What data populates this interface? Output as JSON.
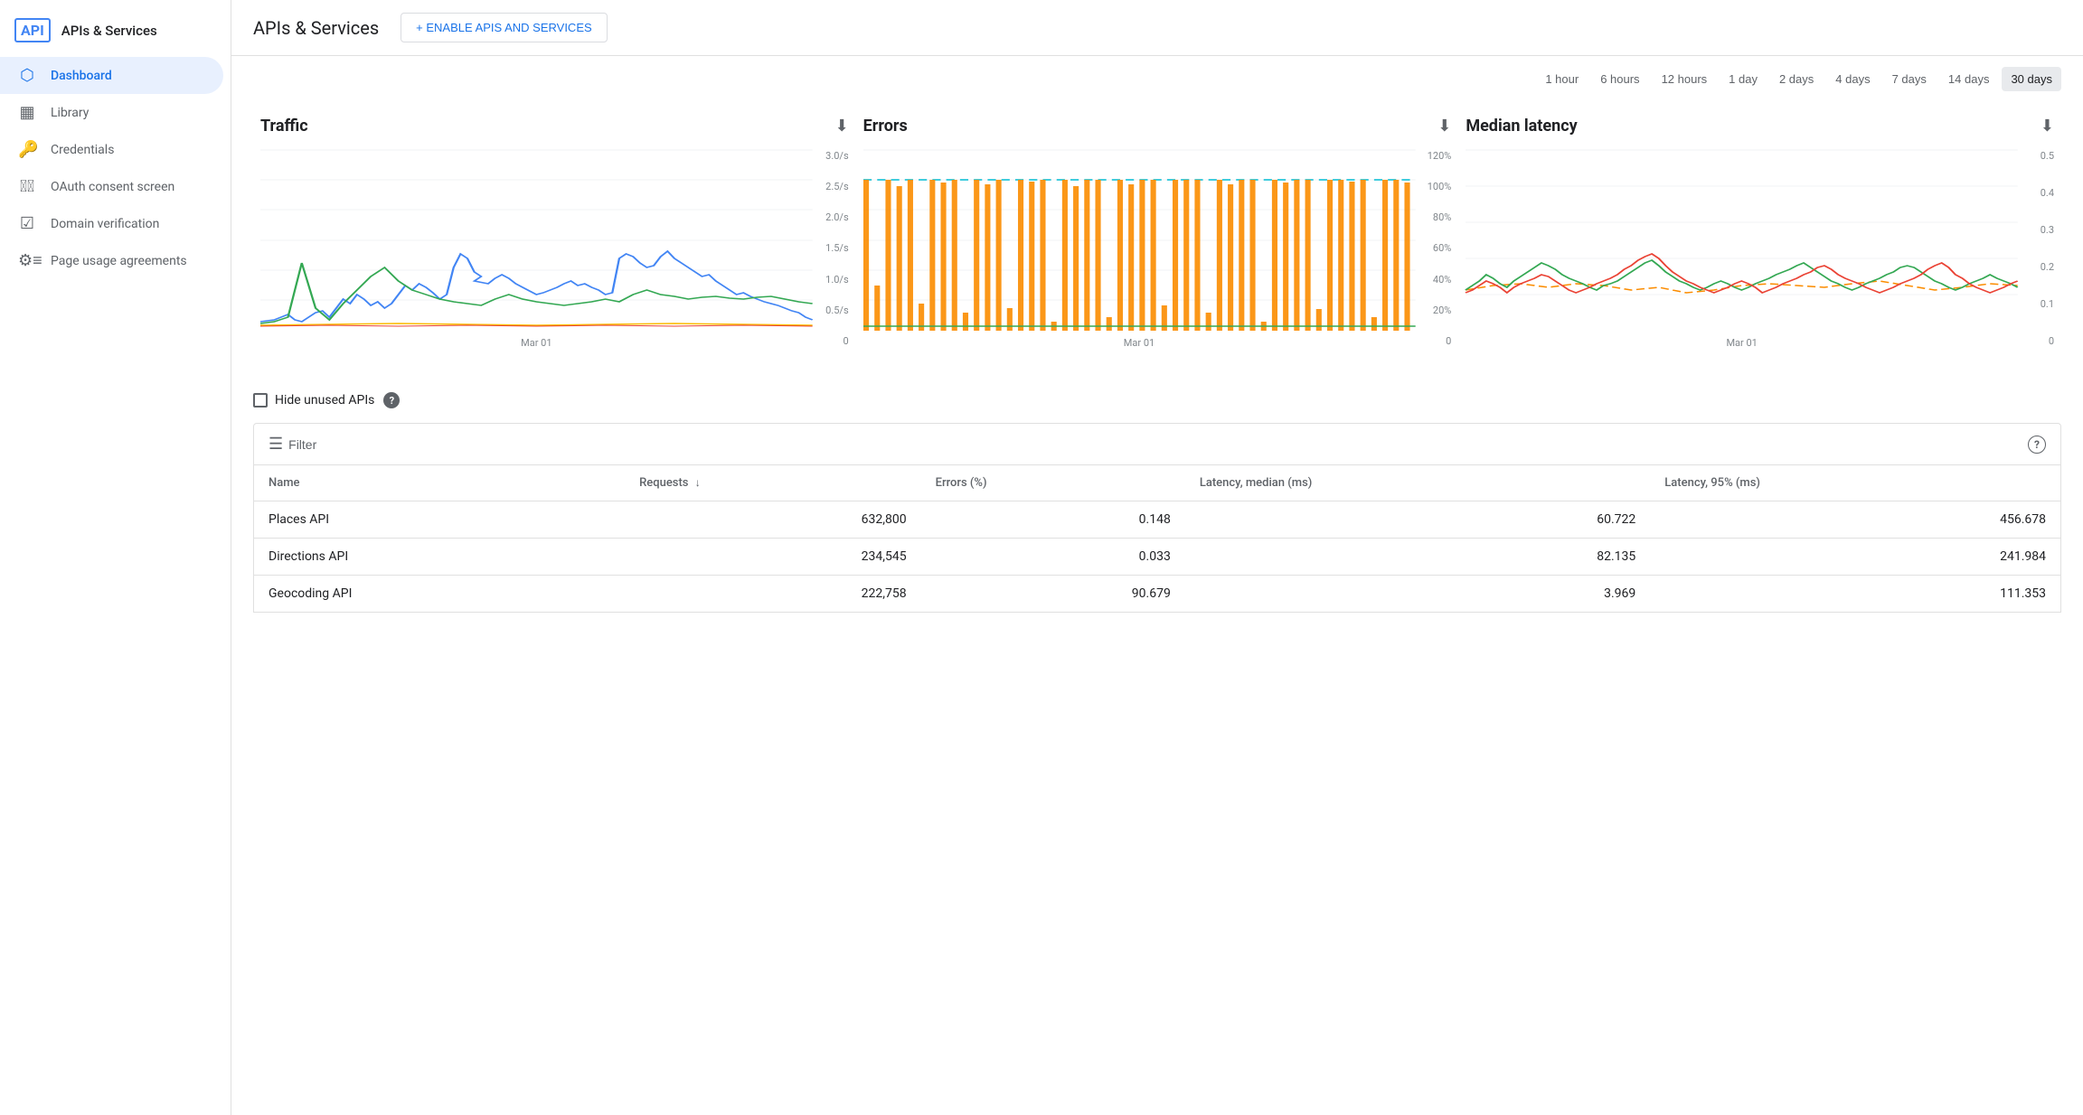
{
  "sidebar": {
    "logo": "API",
    "title": "APIs & Services",
    "items": [
      {
        "id": "dashboard",
        "label": "Dashboard",
        "icon": "⬡",
        "active": true
      },
      {
        "id": "library",
        "label": "Library",
        "icon": "▦"
      },
      {
        "id": "credentials",
        "label": "Credentials",
        "icon": "🔑"
      },
      {
        "id": "oauth",
        "label": "OAuth consent screen",
        "icon": "≡⃞"
      },
      {
        "id": "domain",
        "label": "Domain verification",
        "icon": "☑"
      },
      {
        "id": "page-usage",
        "label": "Page usage agreements",
        "icon": "⚙≡"
      }
    ]
  },
  "header": {
    "title": "APIs & Services",
    "enable_button": "+ ENABLE APIS AND SERVICES"
  },
  "time_ranges": [
    {
      "label": "1 hour",
      "active": false
    },
    {
      "label": "6 hours",
      "active": false
    },
    {
      "label": "12 hours",
      "active": false
    },
    {
      "label": "1 day",
      "active": false
    },
    {
      "label": "2 days",
      "active": false
    },
    {
      "label": "4 days",
      "active": false
    },
    {
      "label": "7 days",
      "active": false
    },
    {
      "label": "14 days",
      "active": false
    },
    {
      "label": "30 days",
      "active": true
    }
  ],
  "charts": [
    {
      "id": "traffic",
      "title": "Traffic",
      "x_label": "Mar 01",
      "y_labels": [
        "3.0/s",
        "2.5/s",
        "2.0/s",
        "1.5/s",
        "1.0/s",
        "0.5/s",
        "0"
      ]
    },
    {
      "id": "errors",
      "title": "Errors",
      "x_label": "Mar 01",
      "y_labels": [
        "120%",
        "100%",
        "80%",
        "60%",
        "40%",
        "20%",
        "0"
      ]
    },
    {
      "id": "latency",
      "title": "Median latency",
      "x_label": "Mar 01",
      "y_labels": [
        "0.5",
        "0.4",
        "0.3",
        "0.2",
        "0.1",
        "0"
      ]
    }
  ],
  "hide_unused": {
    "label": "Hide unused APIs"
  },
  "table": {
    "filter_label": "Filter",
    "columns": [
      {
        "label": "Name",
        "sortable": false
      },
      {
        "label": "Requests",
        "sortable": true
      },
      {
        "label": "Errors (%)",
        "sortable": false
      },
      {
        "label": "Latency, median (ms)",
        "sortable": false
      },
      {
        "label": "Latency, 95% (ms)",
        "sortable": false
      }
    ],
    "rows": [
      {
        "name": "Places API",
        "requests": "632,800",
        "errors": "0.148",
        "latency_median": "60.722",
        "latency_95": "456.678"
      },
      {
        "name": "Directions API",
        "requests": "234,545",
        "errors": "0.033",
        "latency_median": "82.135",
        "latency_95": "241.984"
      },
      {
        "name": "Geocoding API",
        "requests": "222,758",
        "errors": "90.679",
        "latency_median": "3.969",
        "latency_95": "111.353"
      }
    ]
  }
}
